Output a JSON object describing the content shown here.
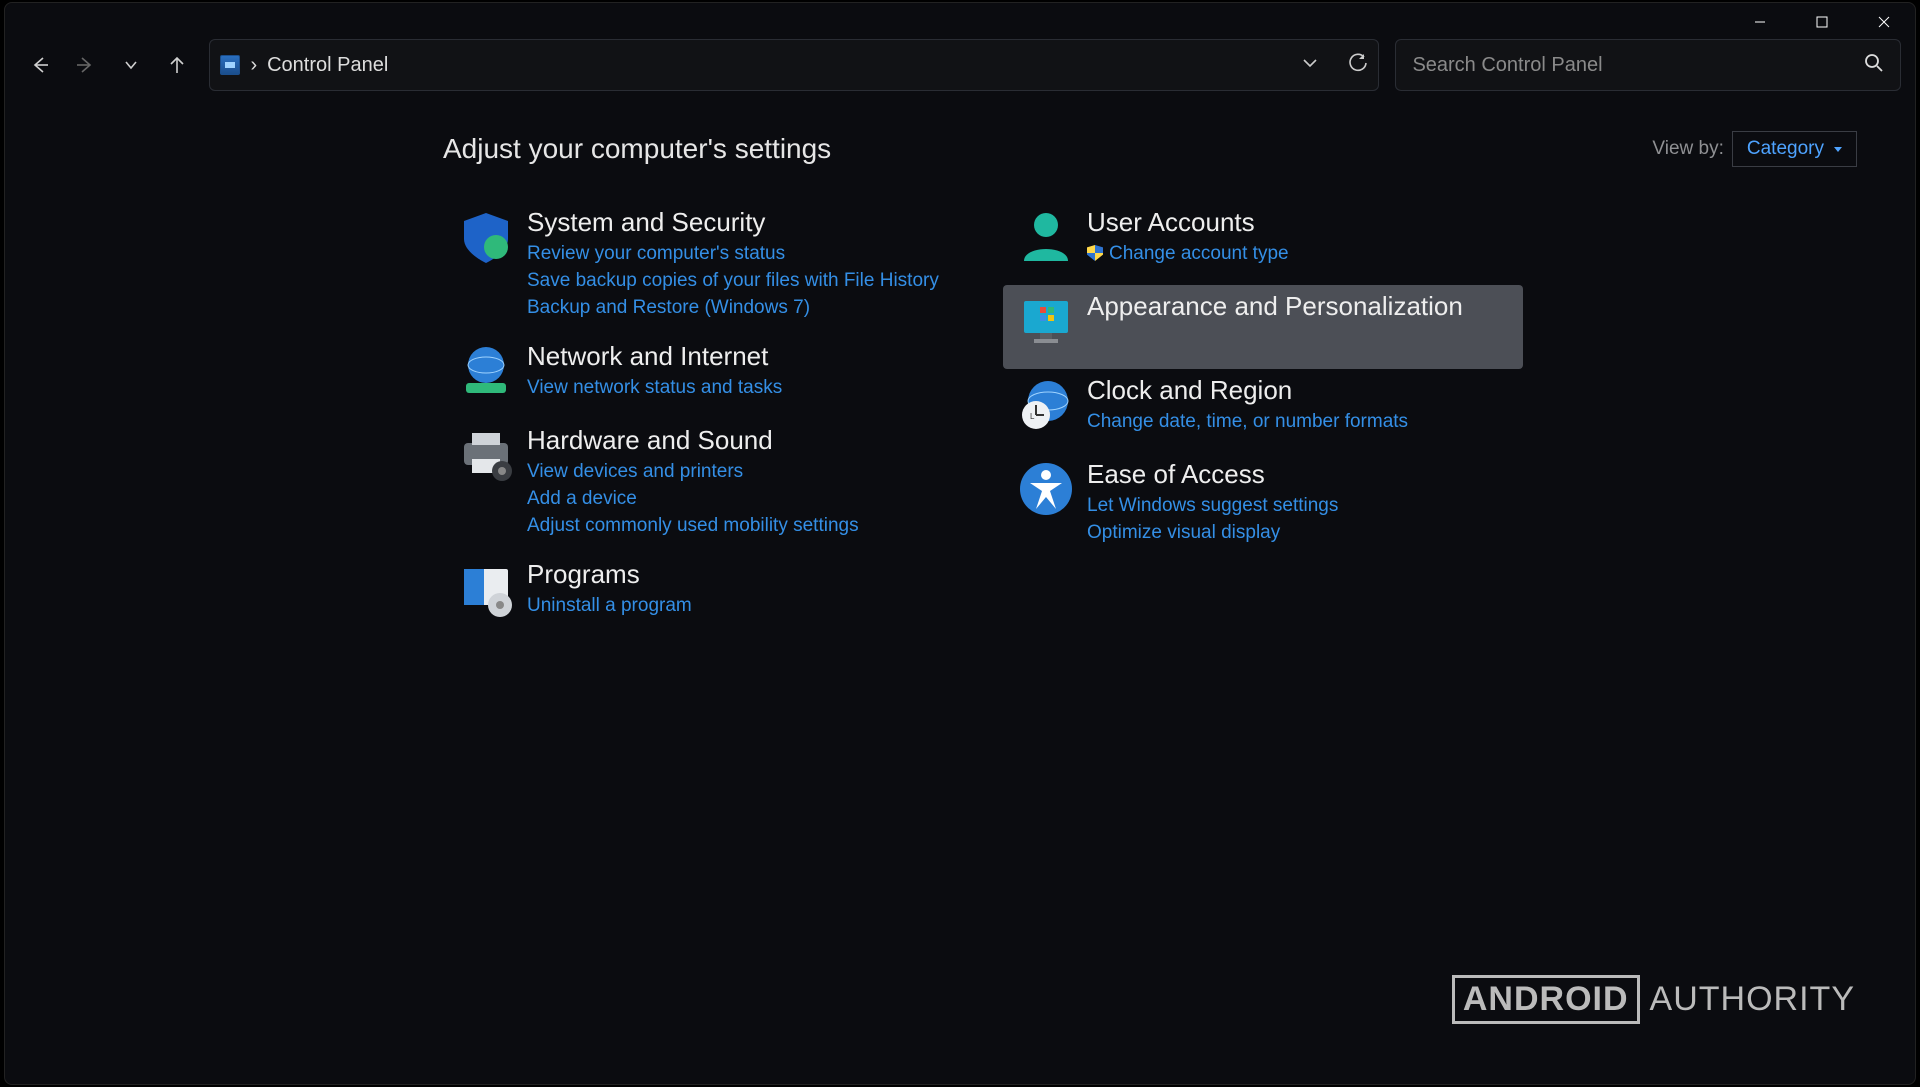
{
  "window": {
    "minimize": "–",
    "maximize": "▢",
    "close": "✕"
  },
  "breadcrumb": {
    "root": "Control Panel",
    "sep": "›"
  },
  "address": {
    "chevron": "⌄",
    "refresh": "↻"
  },
  "search": {
    "placeholder": "Search Control Panel"
  },
  "header": {
    "title": "Adjust your computer's settings"
  },
  "viewby": {
    "label": "View by:",
    "value": "Category"
  },
  "left": {
    "cat0": {
      "title": "System and Security",
      "link0": "Review your computer's status",
      "link1": "Save backup copies of your files with File History",
      "link2": "Backup and Restore (Windows 7)"
    },
    "cat1": {
      "title": "Network and Internet",
      "link0": "View network status and tasks"
    },
    "cat2": {
      "title": "Hardware and Sound",
      "link0": "View devices and printers",
      "link1": "Add a device",
      "link2": "Adjust commonly used mobility settings"
    },
    "cat3": {
      "title": "Programs",
      "link0": "Uninstall a program"
    }
  },
  "right": {
    "cat0": {
      "title": "User Accounts",
      "link0": "Change account type"
    },
    "cat1": {
      "title": "Appearance and Personalization"
    },
    "cat2": {
      "title": "Clock and Region",
      "link0": "Change date, time, or number formats"
    },
    "cat3": {
      "title": "Ease of Access",
      "link0": "Let Windows suggest settings",
      "link1": "Optimize visual display"
    }
  },
  "watermark": {
    "boxed": "ANDROID",
    "plain": "AUTHORITY"
  }
}
